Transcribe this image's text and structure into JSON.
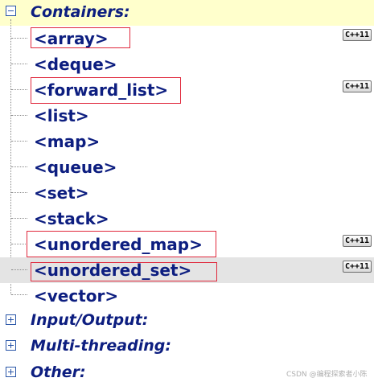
{
  "sections": [
    {
      "label": "Containers:",
      "expanded": true,
      "icon": "minus-icon"
    },
    {
      "label": "Input/Output:",
      "expanded": false,
      "icon": "plus-icon"
    },
    {
      "label": "Multi-threading:",
      "expanded": false,
      "icon": "plus-icon"
    },
    {
      "label": "Other:",
      "expanded": false,
      "icon": "plus-icon"
    }
  ],
  "containers": [
    {
      "label": "<array>",
      "cpp11": true,
      "boxed": true
    },
    {
      "label": "<deque>",
      "cpp11": false,
      "boxed": false
    },
    {
      "label": "<forward_list>",
      "cpp11": true,
      "boxed": true
    },
    {
      "label": "<list>",
      "cpp11": false,
      "boxed": false
    },
    {
      "label": "<map>",
      "cpp11": false,
      "boxed": false
    },
    {
      "label": "<queue>",
      "cpp11": false,
      "boxed": false
    },
    {
      "label": "<set>",
      "cpp11": false,
      "boxed": false
    },
    {
      "label": "<stack>",
      "cpp11": false,
      "boxed": false
    },
    {
      "label": "<unordered_map>",
      "cpp11": true,
      "boxed": true
    },
    {
      "label": "<unordered_set>",
      "cpp11": true,
      "boxed": true,
      "highlighted": true
    },
    {
      "label": "<vector>",
      "cpp11": false,
      "boxed": false
    }
  ],
  "badge_text": "C++11",
  "watermark": "CSDN @编程探索者小陈",
  "colors": {
    "link": "#0d1e80",
    "header_bg": "#ffffcc",
    "highlight_bg": "#e4e4e4",
    "annotation": "#e0283c"
  }
}
